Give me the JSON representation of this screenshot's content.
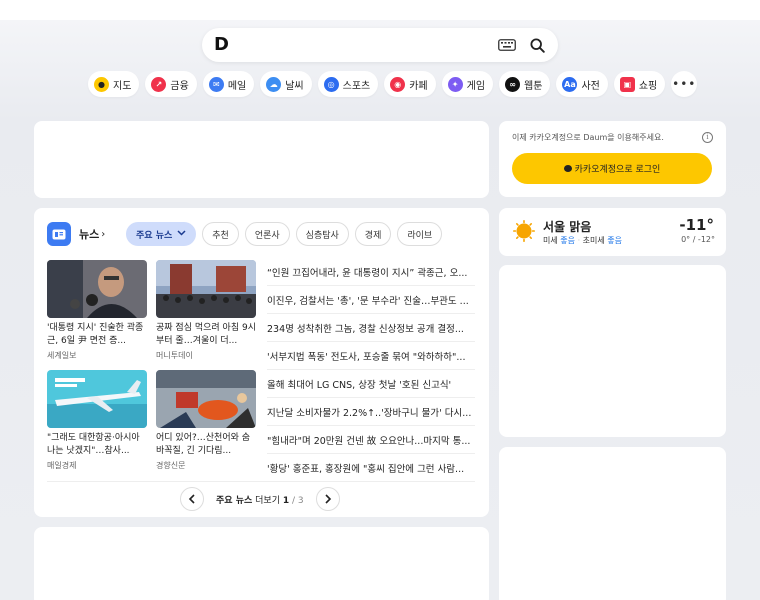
{
  "search": {
    "logo": "D",
    "keyboard_icon": "keyboard-icon",
    "search_icon": "search-icon"
  },
  "services": [
    {
      "label": "지도",
      "icon": "map-pin-icon",
      "color": "#fdc700"
    },
    {
      "label": "금융",
      "icon": "chart-icon",
      "color": "#f0324b"
    },
    {
      "label": "메일",
      "icon": "mail-icon",
      "color": "#3d7bf2"
    },
    {
      "label": "날씨",
      "icon": "cloud-icon",
      "color": "#3d8ef2"
    },
    {
      "label": "스포츠",
      "icon": "sports-icon",
      "color": "#2c6cf0"
    },
    {
      "label": "카페",
      "icon": "cafe-icon",
      "color": "#f0324b"
    },
    {
      "label": "게임",
      "icon": "game-icon",
      "color": "#7d5cf2"
    },
    {
      "label": "웹툰",
      "icon": "webtoon-icon",
      "color": "#111111"
    },
    {
      "label": "사전",
      "icon": "dictionary-icon",
      "color": "#2c6cf0"
    },
    {
      "label": "쇼핑",
      "icon": "shopping-icon",
      "color": "#f0324b"
    }
  ],
  "login": {
    "message": "이제 카카오계정으로 Daum을 이용해주세요.",
    "button_label": "카카오계정으로 로그인",
    "button_color": "#fdc700"
  },
  "weather": {
    "title": "서울 맑음",
    "fine_dust_label": "미세",
    "fine_dust_value": "좋음",
    "ultra_fine_label": "초미세",
    "ultra_fine_value": "좋음",
    "temperature": "-11°",
    "range": "0° / -12°"
  },
  "news": {
    "title": "뉴스",
    "tabs": [
      "주요 뉴스",
      "추천",
      "언론사",
      "심층탐사",
      "경제",
      "라이브"
    ],
    "thumbs": [
      {
        "caption": "'대통령 지시' 진술한 곽종근, 6일 尹 면전 증...",
        "source": "세계일보"
      },
      {
        "caption": "공짜 점심 먹으려 아침 9시부터 줄…겨울이 더...",
        "source": "머니투데이"
      },
      {
        "caption": "\"그래도 대한항공·아시아나는 낫겠지\"…참사...",
        "source": "매일경제"
      },
      {
        "caption": "어디 있어?…산천어와 숨바꼭질, 긴 기다림...",
        "source": "경향신문"
      }
    ],
    "headlines": [
      "“인원 끄집어내라, 윤 대통령이 지시” 곽종근, 오...",
      "이진우, 검찰서는 '총', '문 부수라' 진술…부관도 ...",
      "234명 성착취한 그놈, 경찰 신상정보 공개 결정...",
      "'서부지법 폭동' 전도사, 포승줄 묶여 \"와하하하\"...",
      "올해 최대어 LG CNS, 상장 첫날 '호된 신고식'",
      "지난달 소비자물가 2.2%↑..'장바구니 물가' 다시...",
      "\"힘내라\"며 20만원 건넨 故 오요안나...마지막 통...",
      "'황당' 홍준표, 홍장원에 \"홍씨 집안에 그런 사람..."
    ],
    "pager": {
      "label": "주요 뉴스",
      "more": "더보기",
      "current": "1",
      "separator": "/",
      "total": "3"
    }
  }
}
